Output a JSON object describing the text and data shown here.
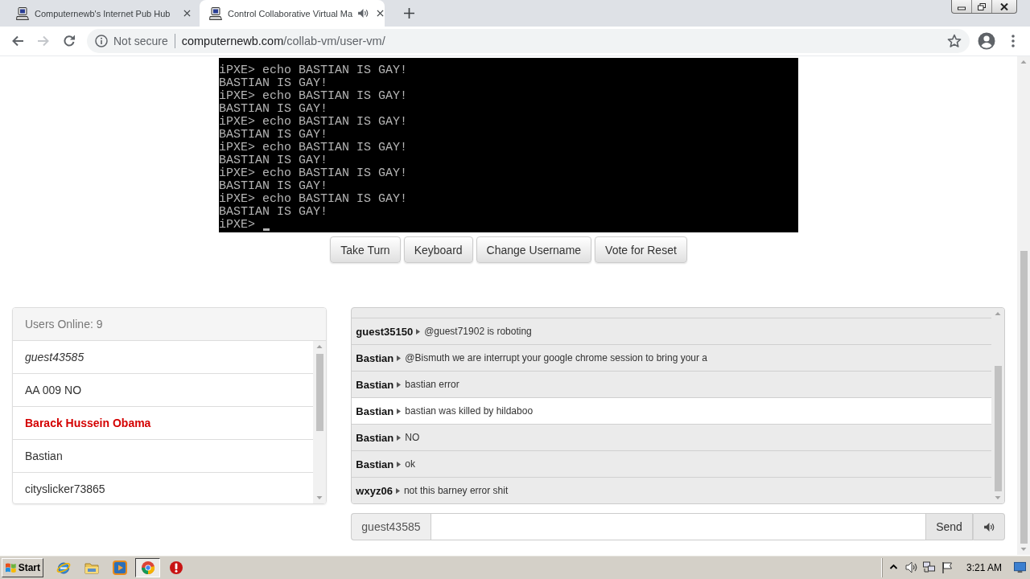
{
  "browser": {
    "tabs": [
      {
        "title": "Computernewb's Internet Pub Hub",
        "selected": false,
        "audio": false
      },
      {
        "title": "Control Collaborative Virtual Ma",
        "selected": true,
        "audio": true
      }
    ],
    "forward_disabled": true,
    "address": {
      "security": "Not secure",
      "domain": "computernewb.com",
      "path": "/collab-vm/user-vm/"
    }
  },
  "vm": {
    "lines": [
      "iPXE> echo BASTIAN IS GAY!",
      "BASTIAN IS GAY!",
      "iPXE> echo BASTIAN IS GAY!",
      "BASTIAN IS GAY!",
      "iPXE> echo BASTIAN IS GAY!",
      "BASTIAN IS GAY!",
      "iPXE> echo BASTIAN IS GAY!",
      "BASTIAN IS GAY!",
      "iPXE> echo BASTIAN IS GAY!",
      "BASTIAN IS GAY!",
      "iPXE> echo BASTIAN IS GAY!",
      "BASTIAN IS GAY!"
    ],
    "prompt": "iPXE>"
  },
  "vm_buttons": [
    "Take Turn",
    "Keyboard",
    "Change Username",
    "Vote for Reset"
  ],
  "users": {
    "title": "Users Online: 9",
    "list": [
      {
        "name": "guest43585",
        "kind": "self"
      },
      {
        "name": "AA 009 NO",
        "kind": "user"
      },
      {
        "name": "Barack Hussein Obama",
        "kind": "admin"
      },
      {
        "name": "Bastian",
        "kind": "user"
      },
      {
        "name": "cityslicker73865",
        "kind": "user"
      }
    ]
  },
  "chat": {
    "messages": [
      {
        "user": "guest35150",
        "text": "@guest71902 is roboting",
        "hovered": false
      },
      {
        "user": "Bastian",
        "text": "@Bismuth we are interrupt your google chrome session to bring your a",
        "hovered": false
      },
      {
        "user": "Bastian",
        "text": "bastian error",
        "hovered": false
      },
      {
        "user": "Bastian",
        "text": "bastian was killed by hildaboo",
        "hovered": true
      },
      {
        "user": "Bastian",
        "text": "NO",
        "hovered": false
      },
      {
        "user": "Bastian",
        "text": "ok",
        "hovered": false
      },
      {
        "user": "wxyz06",
        "text": "not this barney error shit",
        "hovered": false
      }
    ]
  },
  "chat_input": {
    "username": "guest43585",
    "send": "Send"
  },
  "taskbar": {
    "start": "Start",
    "apps": [
      {
        "kind": "globe",
        "active": false
      },
      {
        "kind": "folder",
        "active": false
      },
      {
        "kind": "player",
        "active": false
      },
      {
        "kind": "browser",
        "active": true
      },
      {
        "kind": "alert",
        "active": false
      }
    ],
    "clock": "3:21 AM"
  }
}
